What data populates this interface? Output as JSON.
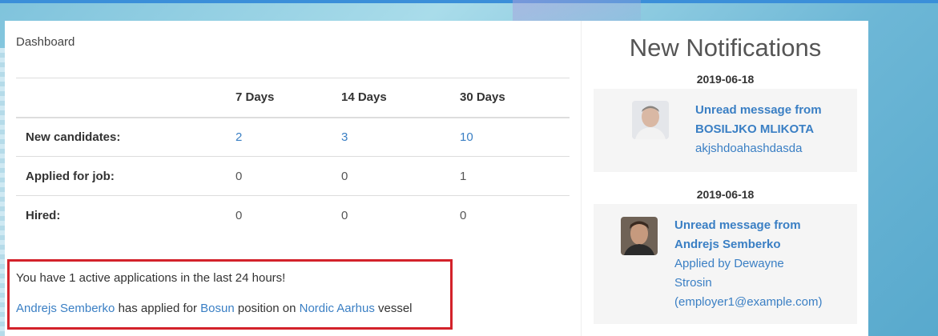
{
  "dashboard": {
    "title": "Dashboard",
    "columns": [
      "",
      "7 Days",
      "14 Days",
      "30 Days"
    ],
    "rows": [
      {
        "label": "New candidates:",
        "values": [
          "2",
          "3",
          "10"
        ],
        "linked": true
      },
      {
        "label": "Applied for job:",
        "values": [
          "0",
          "0",
          "1"
        ],
        "linked": false
      },
      {
        "label": "Hired:",
        "values": [
          "0",
          "0",
          "0"
        ],
        "linked": false
      }
    ]
  },
  "activity": {
    "summary": "You have 1 active applications in the last 24 hours!",
    "candidate": "Andrejs Semberko",
    "text1": "has applied for",
    "position": "Bosun",
    "text2": "position on",
    "vessel": "Nordic Aarhus",
    "text3": "vessel"
  },
  "notifications": {
    "heading": "New Notifications",
    "items": [
      {
        "date": "2019-06-18",
        "title_line1": "Unread message from",
        "title_line2": "BOSILJKO MLIKOTA",
        "body_lines": [
          "akjshdoahashdasda"
        ]
      },
      {
        "date": "2019-06-18",
        "title_line1": "Unread message from",
        "title_line2": "Andrejs Semberko",
        "body_lines": [
          "Applied by Dewayne",
          "Strosin",
          "(employer1@example.com)"
        ]
      }
    ]
  },
  "colors": {
    "accent": "#3a7fc4",
    "highlight_border": "#d3222a"
  }
}
